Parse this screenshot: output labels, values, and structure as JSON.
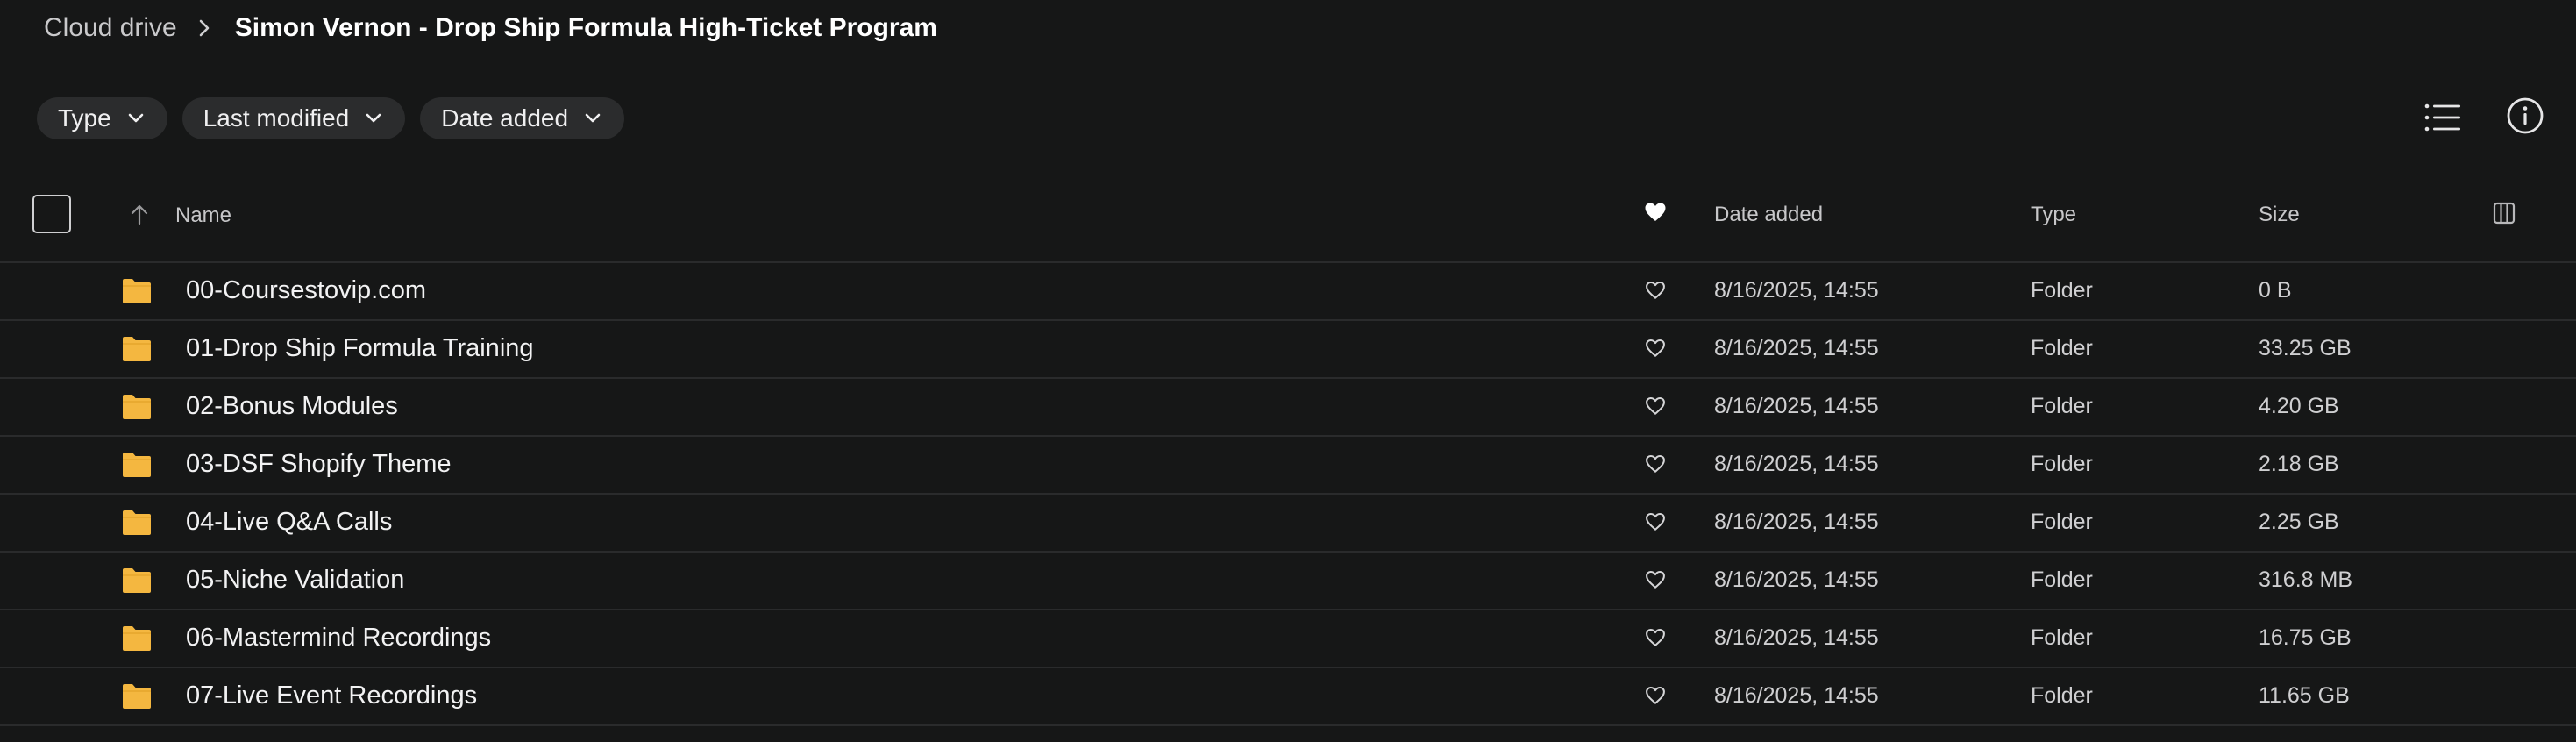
{
  "breadcrumb": {
    "root": "Cloud drive",
    "current": "Simon Vernon - Drop Ship Formula High-Ticket Program"
  },
  "filters": [
    {
      "label": "Type"
    },
    {
      "label": "Last modified"
    },
    {
      "label": "Date added"
    }
  ],
  "toolbar": {
    "list_view_icon": "list-view-icon",
    "info_icon": "info-icon"
  },
  "columns": {
    "name": "Name",
    "date_added": "Date added",
    "type": "Type",
    "size": "Size",
    "favourite_icon": "heart-filled-icon",
    "sort_icon": "arrow-up-icon",
    "columns_icon": "columns-icon"
  },
  "rows": [
    {
      "name": "00-Coursestovip.com",
      "date": "8/16/2025, 14:55",
      "type": "Folder",
      "size": "0 B"
    },
    {
      "name": "01-Drop Ship Formula Training",
      "date": "8/16/2025, 14:55",
      "type": "Folder",
      "size": "33.25 GB"
    },
    {
      "name": "02-Bonus Modules",
      "date": "8/16/2025, 14:55",
      "type": "Folder",
      "size": "4.20 GB"
    },
    {
      "name": "03-DSF Shopify Theme",
      "date": "8/16/2025, 14:55",
      "type": "Folder",
      "size": "2.18 GB"
    },
    {
      "name": "04-Live Q&A Calls",
      "date": "8/16/2025, 14:55",
      "type": "Folder",
      "size": "2.25 GB"
    },
    {
      "name": "05-Niche Validation",
      "date": "8/16/2025, 14:55",
      "type": "Folder",
      "size": "316.8 MB"
    },
    {
      "name": "06-Mastermind Recordings",
      "date": "8/16/2025, 14:55",
      "type": "Folder",
      "size": "16.75 GB"
    },
    {
      "name": "07-Live Event Recordings",
      "date": "8/16/2025, 14:55",
      "type": "Folder",
      "size": "11.65 GB"
    }
  ],
  "colors": {
    "background": "#161717",
    "chip": "#2b2c2d",
    "folder": "#f4b740",
    "divider": "#2a2b2c"
  }
}
